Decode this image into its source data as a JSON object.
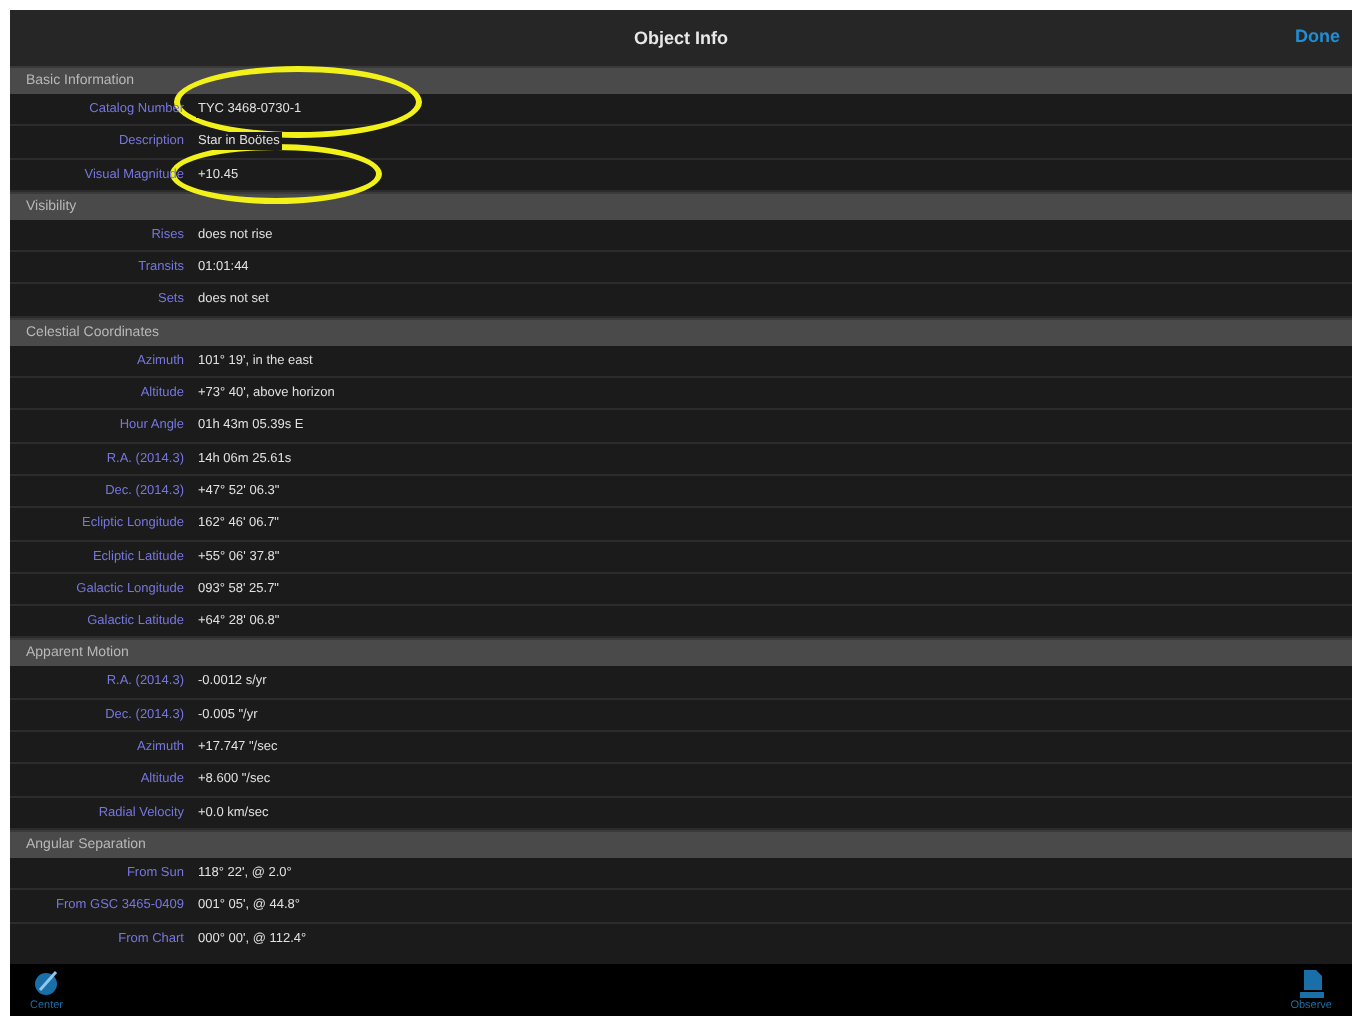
{
  "nav_bar": {
    "title": "Object Info",
    "done_button": "Done"
  },
  "sections": [
    {
      "title": "Basic Information",
      "rows": [
        {
          "label": "Catalog Number",
          "value": "TYC 3468-0730-1",
          "circled": true
        },
        {
          "label": "Description",
          "value": "Star in Boötes"
        },
        {
          "label": "Visual Magnitude",
          "value": "+10.45",
          "circled": true
        }
      ]
    },
    {
      "title": "Visibility",
      "rows": [
        {
          "label": "Rises",
          "value": "does not rise"
        },
        {
          "label": "Transits",
          "value": "01:01:44"
        },
        {
          "label": "Sets",
          "value": "does not set"
        }
      ]
    },
    {
      "title": "Celestial Coordinates",
      "rows": [
        {
          "label": "Azimuth",
          "value": "101° 19', in the east"
        },
        {
          "label": "Altitude",
          "value": "+73° 40', above horizon"
        },
        {
          "label": "Hour Angle",
          "value": "01h 43m 05.39s E"
        },
        {
          "label": "R.A. (2014.3)",
          "value": "14h 06m 25.61s"
        },
        {
          "label": "Dec. (2014.3)",
          "value": "+47° 52' 06.3\""
        },
        {
          "label": "Ecliptic Longitude",
          "value": "162° 46' 06.7\""
        },
        {
          "label": "Ecliptic Latitude",
          "value": "+55° 06' 37.8\""
        },
        {
          "label": "Galactic Longitude",
          "value": "093° 58' 25.7\""
        },
        {
          "label": "Galactic Latitude",
          "value": "+64° 28' 06.8\""
        }
      ]
    },
    {
      "title": "Apparent Motion",
      "rows": [
        {
          "label": "R.A. (2014.3)",
          "value": "-0.0012 s/yr"
        },
        {
          "label": "Dec. (2014.3)",
          "value": "-0.005 \"/yr"
        },
        {
          "label": "Azimuth",
          "value": "+17.747 \"/sec"
        },
        {
          "label": "Altitude",
          "value": "+8.600 \"/sec"
        },
        {
          "label": "Radial Velocity",
          "value": "+0.0 km/sec"
        }
      ]
    },
    {
      "title": "Angular Separation",
      "rows": [
        {
          "label": "From Sun",
          "value": "118° 22', @ 2.0°"
        },
        {
          "label": "From GSC 3465-0409",
          "value": "001° 05', @ 44.8°"
        },
        {
          "label": "From Chart",
          "value": "000° 00', @ 112.4°"
        }
      ]
    }
  ],
  "toolbar": [
    {
      "label": "Center",
      "kind": "center"
    },
    {
      "label": "Observe",
      "kind": "observe"
    }
  ]
}
